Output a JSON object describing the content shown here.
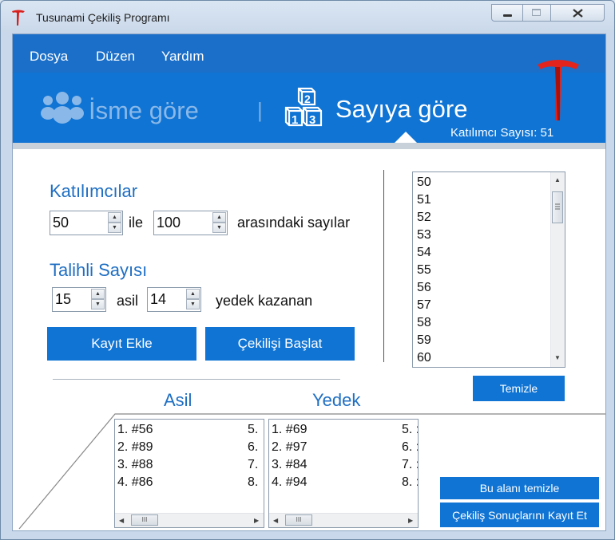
{
  "window": {
    "title": "Tusunami Çekiliş Programı"
  },
  "menu": {
    "items": [
      "Dosya",
      "Düzen",
      "Yardım"
    ]
  },
  "banner": {
    "tab_isme": "İsme göre",
    "separator": "|",
    "tab_sayi": "Sayıya göre",
    "participant_count": "Katılımcı Sayısı: 51",
    "logo_letter": "T"
  },
  "participants": {
    "heading": "Katılımcılar",
    "from_value": "50",
    "between_word": "ile",
    "to_value": "100",
    "suffix": "arasındaki sayılar"
  },
  "winners": {
    "heading": "Talihli Sayısı",
    "main_value": "15",
    "main_label": "asil",
    "reserve_value": "14",
    "reserve_label": "yedek kazanan"
  },
  "buttons": {
    "add_record": "Kayıt Ekle",
    "start_draw": "Çekilişi Başlat",
    "clear": "Temizle",
    "clear_area": "Bu alanı temizle",
    "save_results": "Çekiliş Sonuçlarını Kayıt Et"
  },
  "number_list": [
    "50",
    "51",
    "52",
    "53",
    "54",
    "55",
    "56",
    "57",
    "58",
    "59",
    "60"
  ],
  "results": {
    "asil_heading": "Asil",
    "yedek_heading": "Yedek",
    "asil": [
      "1. #56",
      "2. #89",
      "3. #88",
      "4. #86"
    ],
    "asil_next": [
      "5.",
      "6.",
      "7.",
      "8."
    ],
    "yedek": [
      "1. #69",
      "2. #97",
      "3. #84",
      "4. #94"
    ],
    "yedek_next": [
      "5. :",
      "6. :",
      "7. :",
      "8. :"
    ],
    "scroll_thumb_glyph": "III"
  },
  "colors": {
    "accent": "#0f74d4",
    "menubar": "#1b6fc8",
    "heading": "#1f6fc3"
  }
}
